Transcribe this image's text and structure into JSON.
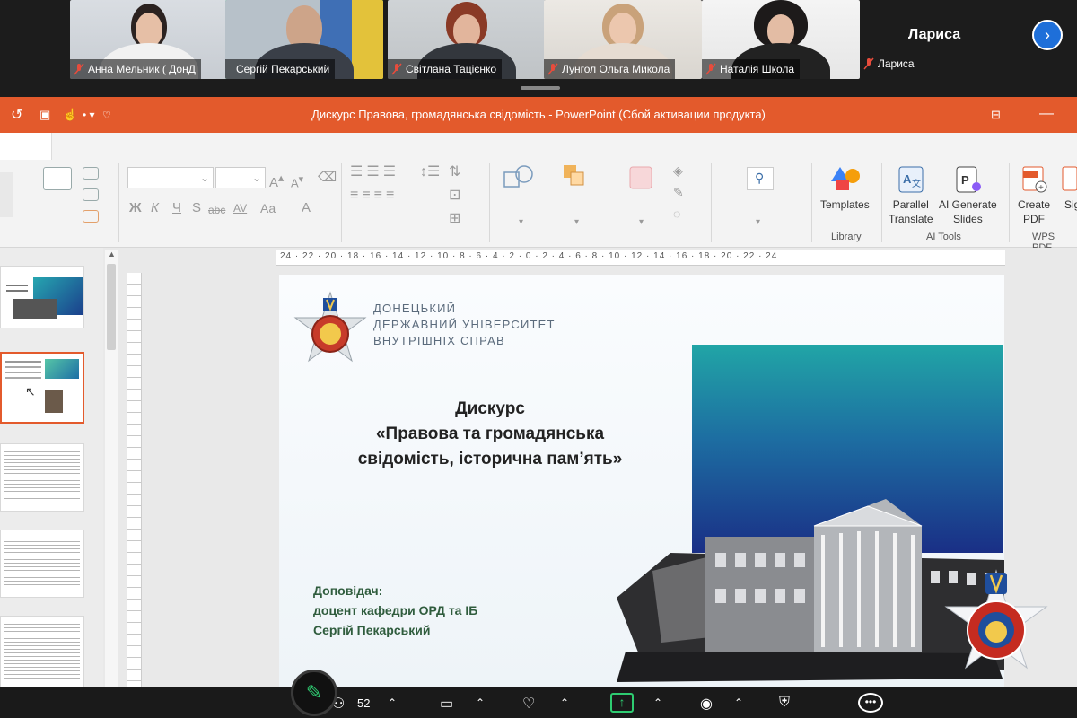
{
  "conference": {
    "participants": [
      {
        "name": "Анна Мельник ( ДонД",
        "muted": true
      },
      {
        "name": "Сергій Пекарський",
        "muted": false
      },
      {
        "name": "Світлана Тацієнко",
        "muted": true
      },
      {
        "name": "Лунгол Ольга Микола",
        "muted": true
      },
      {
        "name": "Наталія Школа",
        "muted": true
      }
    ],
    "active_speaker_name": "Лариса",
    "active_speaker_tag": "Лариса"
  },
  "powerpoint": {
    "window_title": "Дискурс Правова, громадянська свідомість  -  PowerPoint (Сбой активации продукта)"
  },
  "ribbon": {
    "font_buttons": [
      "Ж",
      "К",
      "Ч",
      "S",
      "abc",
      "AV",
      "Aa",
      "A"
    ],
    "templates_label": "Templates",
    "library_label": "Library",
    "parallel_translate_label": [
      "Parallel",
      "Translate"
    ],
    "ai_generate_label": [
      "AI Generate",
      "Slides"
    ],
    "ai_tools_label": "AI Tools",
    "create_pdf_label": [
      "Create",
      "PDF"
    ],
    "sign_label": "Sig",
    "wps_pdf_label": "WPS PDF"
  },
  "ruler": {
    "horizontal": "24 · 22 · 20 · 18 · 16 · 14 · 12 · 10 · 8 · 6 · 4 · 2 · 0 · 2 · 4 · 6 · 8 · 10 · 12 · 14 · 16 · 18 · 20 · 22 · 24"
  },
  "slide": {
    "university_lines": [
      "ДОНЕЦЬКИЙ",
      "ДЕРЖАВНИЙ УНІВЕРСИТЕТ",
      "ВНУТРІШНІХ СПРАВ"
    ],
    "heading_lines": [
      "Дискурс",
      "«Правова та громадянська",
      "свідомість, історична пам’ять»"
    ],
    "presenter_lines": [
      "Доповідач:",
      "доцент кафедри ОРД та ІБ",
      "Сергій Пекарський"
    ]
  },
  "bottom_bar": {
    "participant_count": "52"
  },
  "colors": {
    "ppt_accent": "#e35a2c",
    "active_tile_border": "#2ecc71",
    "next_button": "#1e6fd9",
    "presenter_text": "#2f5c3d"
  }
}
